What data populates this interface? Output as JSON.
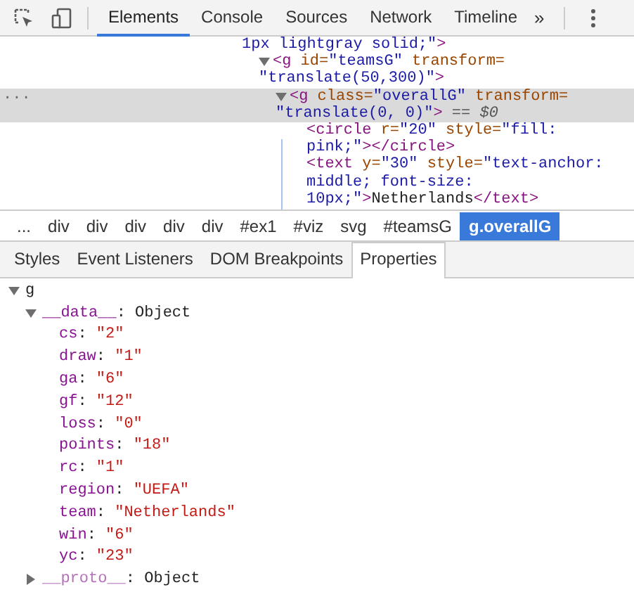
{
  "toolbar": {
    "tabs": [
      {
        "label": "Elements",
        "selected": true
      },
      {
        "label": "Console",
        "selected": false
      },
      {
        "label": "Sources",
        "selected": false
      },
      {
        "label": "Network",
        "selected": false
      },
      {
        "label": "Timeline",
        "selected": false
      }
    ],
    "overflow": "»"
  },
  "dom_tree": {
    "lines_above": [
      [
        {
          "kind": "value",
          "t": "1px lightgray solid;\""
        },
        {
          "kind": "tag",
          "t": ">"
        }
      ]
    ],
    "nodes": [
      {
        "expanded": true,
        "selected": false,
        "lines": [
          [
            {
              "kind": "tag",
              "t": "<g"
            },
            {
              "kind": "attr",
              "t": " id="
            },
            {
              "kind": "value",
              "t": "\"teamsG\""
            },
            {
              "kind": "attr",
              "t": " transform="
            }
          ],
          [
            {
              "kind": "value",
              "t": "\"translate(50,300)\""
            },
            {
              "kind": "tag",
              "t": ">"
            }
          ]
        ],
        "children": [
          {
            "expanded": true,
            "selected": true,
            "lines": [
              [
                {
                  "kind": "tag",
                  "t": "<g"
                },
                {
                  "kind": "attr",
                  "t": " class="
                },
                {
                  "kind": "value",
                  "t": "\"overallG\""
                },
                {
                  "kind": "attr",
                  "t": " transform="
                }
              ],
              [
                {
                  "kind": "value",
                  "t": "\"translate(0, 0)\""
                },
                {
                  "kind": "tag",
                  "t": ">"
                },
                {
                  "kind": "meta",
                  "t": " == "
                },
                {
                  "kind": "ref",
                  "t": "$0"
                }
              ]
            ],
            "children": [
              {
                "selected": false,
                "lines": [
                  [
                    {
                      "kind": "tag",
                      "t": "<circle"
                    },
                    {
                      "kind": "attr",
                      "t": " r="
                    },
                    {
                      "kind": "value",
                      "t": "\"20\""
                    },
                    {
                      "kind": "attr",
                      "t": " style="
                    },
                    {
                      "kind": "value",
                      "t": "\"fill:"
                    }
                  ],
                  [
                    {
                      "kind": "value",
                      "t": "pink;\""
                    },
                    {
                      "kind": "tag",
                      "t": "></circle>"
                    }
                  ]
                ]
              },
              {
                "selected": false,
                "lines": [
                  [
                    {
                      "kind": "tag",
                      "t": "<text"
                    },
                    {
                      "kind": "attr",
                      "t": " y="
                    },
                    {
                      "kind": "value",
                      "t": "\"30\""
                    },
                    {
                      "kind": "attr",
                      "t": " style="
                    },
                    {
                      "kind": "value",
                      "t": "\"text-anchor:"
                    }
                  ],
                  [
                    {
                      "kind": "value",
                      "t": "middle; font-size:"
                    }
                  ],
                  [
                    {
                      "kind": "value",
                      "t": "10px;\""
                    },
                    {
                      "kind": "tag",
                      "t": ">"
                    },
                    {
                      "kind": "text",
                      "t": "Netherlands"
                    },
                    {
                      "kind": "tag",
                      "t": "</text>"
                    }
                  ]
                ]
              }
            ]
          }
        ]
      }
    ],
    "selected_marker": "..."
  },
  "breadcrumbs": [
    {
      "label": "...",
      "selected": false
    },
    {
      "label": "div",
      "selected": false
    },
    {
      "label": "div",
      "selected": false
    },
    {
      "label": "div",
      "selected": false
    },
    {
      "label": "div",
      "selected": false
    },
    {
      "label": "div",
      "selected": false
    },
    {
      "label": "#ex1",
      "selected": false
    },
    {
      "label": "#viz",
      "selected": false
    },
    {
      "label": "svg",
      "selected": false
    },
    {
      "label": "#teamsG",
      "selected": false
    },
    {
      "label": "g.overallG",
      "selected": true
    }
  ],
  "sidebar_tabs": [
    {
      "label": "Styles",
      "selected": false
    },
    {
      "label": "Event Listeners",
      "selected": false
    },
    {
      "label": "DOM Breakpoints",
      "selected": false
    },
    {
      "label": "Properties",
      "selected": true
    }
  ],
  "properties": [
    {
      "key": "g",
      "expanded": true,
      "children": [
        {
          "key": "__data__",
          "separator": ":",
          "value": "Object",
          "kind": "object",
          "expanded": true,
          "children": [
            {
              "key": "cs",
              "separator": ":",
              "value": "\"2\"",
              "kind": "string"
            },
            {
              "key": "draw",
              "separator": ":",
              "value": "\"1\"",
              "kind": "string"
            },
            {
              "key": "ga",
              "separator": ":",
              "value": "\"6\"",
              "kind": "string"
            },
            {
              "key": "gf",
              "separator": ":",
              "value": "\"12\"",
              "kind": "string"
            },
            {
              "key": "loss",
              "separator": ":",
              "value": "\"0\"",
              "kind": "string"
            },
            {
              "key": "points",
              "separator": ":",
              "value": "\"18\"",
              "kind": "string"
            },
            {
              "key": "rc",
              "separator": ":",
              "value": "\"1\"",
              "kind": "string"
            },
            {
              "key": "region",
              "separator": ":",
              "value": "\"UEFA\"",
              "kind": "string"
            },
            {
              "key": "team",
              "separator": ":",
              "value": "\"Netherlands\"",
              "kind": "string"
            },
            {
              "key": "win",
              "separator": ":",
              "value": "\"6\"",
              "kind": "string"
            },
            {
              "key": "yc",
              "separator": ":",
              "value": "\"23\"",
              "kind": "string"
            }
          ]
        },
        {
          "key": "__proto__",
          "separator": ":",
          "value": "Object",
          "kind": "object",
          "expanded": false
        }
      ]
    }
  ]
}
